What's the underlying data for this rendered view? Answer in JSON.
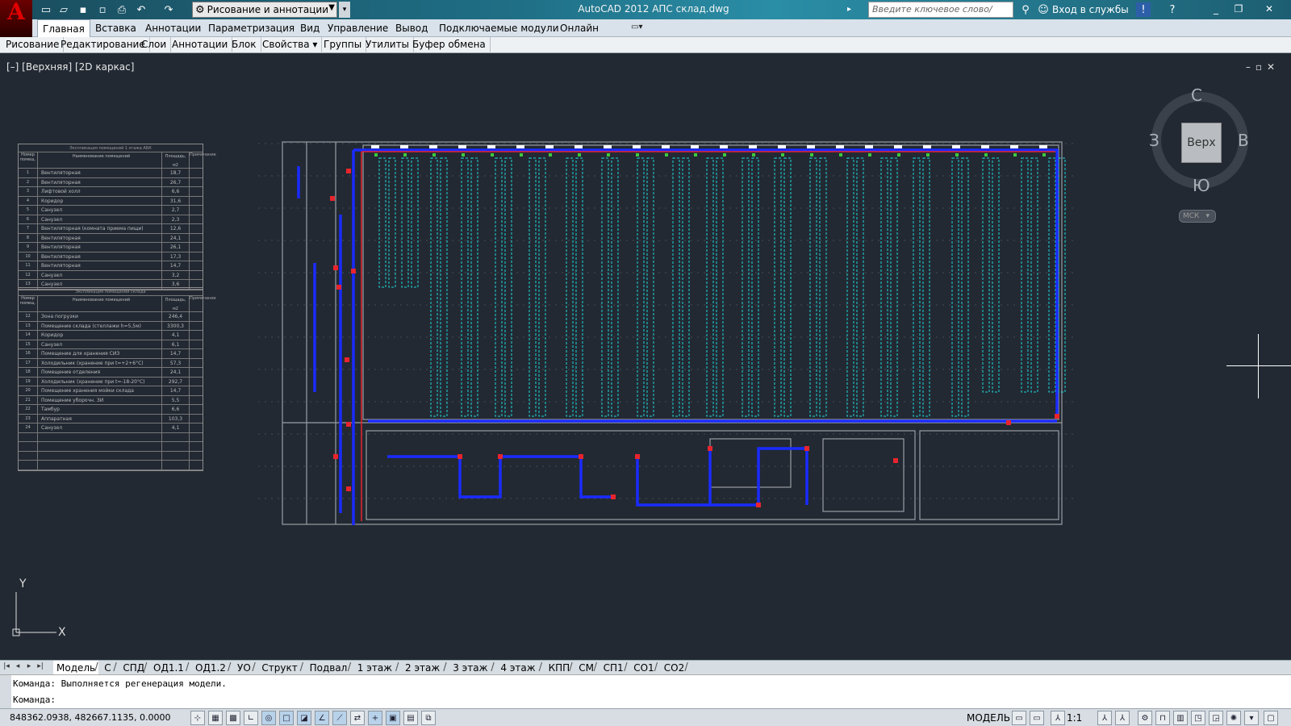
{
  "titlebar": {
    "workspace": "Рисование и аннотации",
    "document_title": "AutoCAD 2012   АПС склад.dwg",
    "search_placeholder": "Введите ключевое слово/фразу",
    "signin": "Вход в службы"
  },
  "menu": {
    "tabs": [
      "Главная",
      "Вставка",
      "Аннотации",
      "Параметризация",
      "Вид",
      "Управление",
      "Вывод",
      "Подключаемые модули",
      "Онлайн"
    ],
    "active": "Главная"
  },
  "panels": [
    "Рисование",
    "Редактирование",
    "Слои",
    "Аннотации",
    "Блок",
    "Свойства ▾",
    "Группы",
    "Утилиты",
    "Буфер обмена"
  ],
  "viewport": {
    "label": "[–] [Верхняя] [2D каркас]",
    "controls": "–▫✕"
  },
  "viewcube": {
    "north": "С",
    "south": "Ю",
    "west": "З",
    "east": "В",
    "face": "Верх",
    "ucs": "МСК"
  },
  "ucs_axes": {
    "x": "X",
    "y": "Y"
  },
  "layout_tabs": [
    "Модель",
    "С",
    "СПД",
    "ОД1.1",
    "ОД1.2",
    "УО",
    "Структ",
    "Подвал",
    "1 этаж",
    "2 этаж",
    "3 этаж",
    "4 этаж",
    "КПП",
    "СМ",
    "СП1",
    "СО1",
    "СО2"
  ],
  "active_layout": "Модель",
  "command": {
    "history": "Команда:  Выполняется регенерация модели.",
    "prompt": "Команда:"
  },
  "status": {
    "coords": "848362.0938, 482667.1135, 0.0000",
    "model": "МОДЕЛЬ",
    "scale": "1:1"
  },
  "table1": {
    "title": "Экспликация помещений 1 этажа АБК",
    "header": [
      "Номер помещ.",
      "Наименование помещений",
      "Площадь, м2",
      "Примечание"
    ],
    "rows": [
      [
        "1",
        "Вентиляторная",
        "18,7"
      ],
      [
        "2",
        "Вентиляторная",
        "26,7"
      ],
      [
        "3",
        "Лифтовой холл",
        "6,6"
      ],
      [
        "4",
        "Коридор",
        "31,6"
      ],
      [
        "5",
        "Санузел",
        "2,7"
      ],
      [
        "6",
        "Санузел",
        "2,3"
      ],
      [
        "7",
        "Вентиляторная (комната приема пищи)",
        "12,6"
      ],
      [
        "8",
        "Вентиляторная",
        "24,1"
      ],
      [
        "9",
        "Вентиляторная",
        "26,1"
      ],
      [
        "10",
        "Вентиляторная",
        "17,3"
      ],
      [
        "11",
        "Вентиляторная",
        "14,7"
      ],
      [
        "12",
        "Санузел",
        "3,2"
      ],
      [
        "13",
        "Санузел",
        "3,6"
      ]
    ]
  },
  "table2": {
    "title": "Экспликация помещений склада",
    "header": [
      "Номер помещ.",
      "Наименование помещений",
      "Площадь, м2",
      "Примечание"
    ],
    "rows": [
      [
        "12",
        "Зона погрузки",
        "246,4"
      ],
      [
        "13",
        "Помещение склада (стеллажи h=5,5м)",
        "3300,3"
      ],
      [
        "14",
        "Коридор",
        "4,1"
      ],
      [
        "15",
        "Санузел",
        "6,1"
      ],
      [
        "16",
        "Помещение для хранения СИЗ",
        "14,7"
      ],
      [
        "17",
        "Холодильник (хранение при t=+2+6°С)",
        "57,3"
      ],
      [
        "18",
        "Помещение отделения",
        "24,1"
      ],
      [
        "19",
        "Холодильник (хранение при t=-18-20°С)",
        "292,7"
      ],
      [
        "20",
        "Помещение хранения мойки склада",
        "14,7"
      ],
      [
        "21",
        "Помещение уборочн. ЗИ",
        "5,5"
      ],
      [
        "22",
        "Тамбур",
        "6,6"
      ],
      [
        "23",
        "Аппаратная",
        "103,3"
      ],
      [
        "24",
        "Санузел",
        "4,1"
      ],
      [
        "",
        "",
        " "
      ],
      [
        "",
        "",
        " "
      ],
      [
        "",
        "",
        " "
      ],
      [
        "",
        "",
        " "
      ]
    ]
  }
}
